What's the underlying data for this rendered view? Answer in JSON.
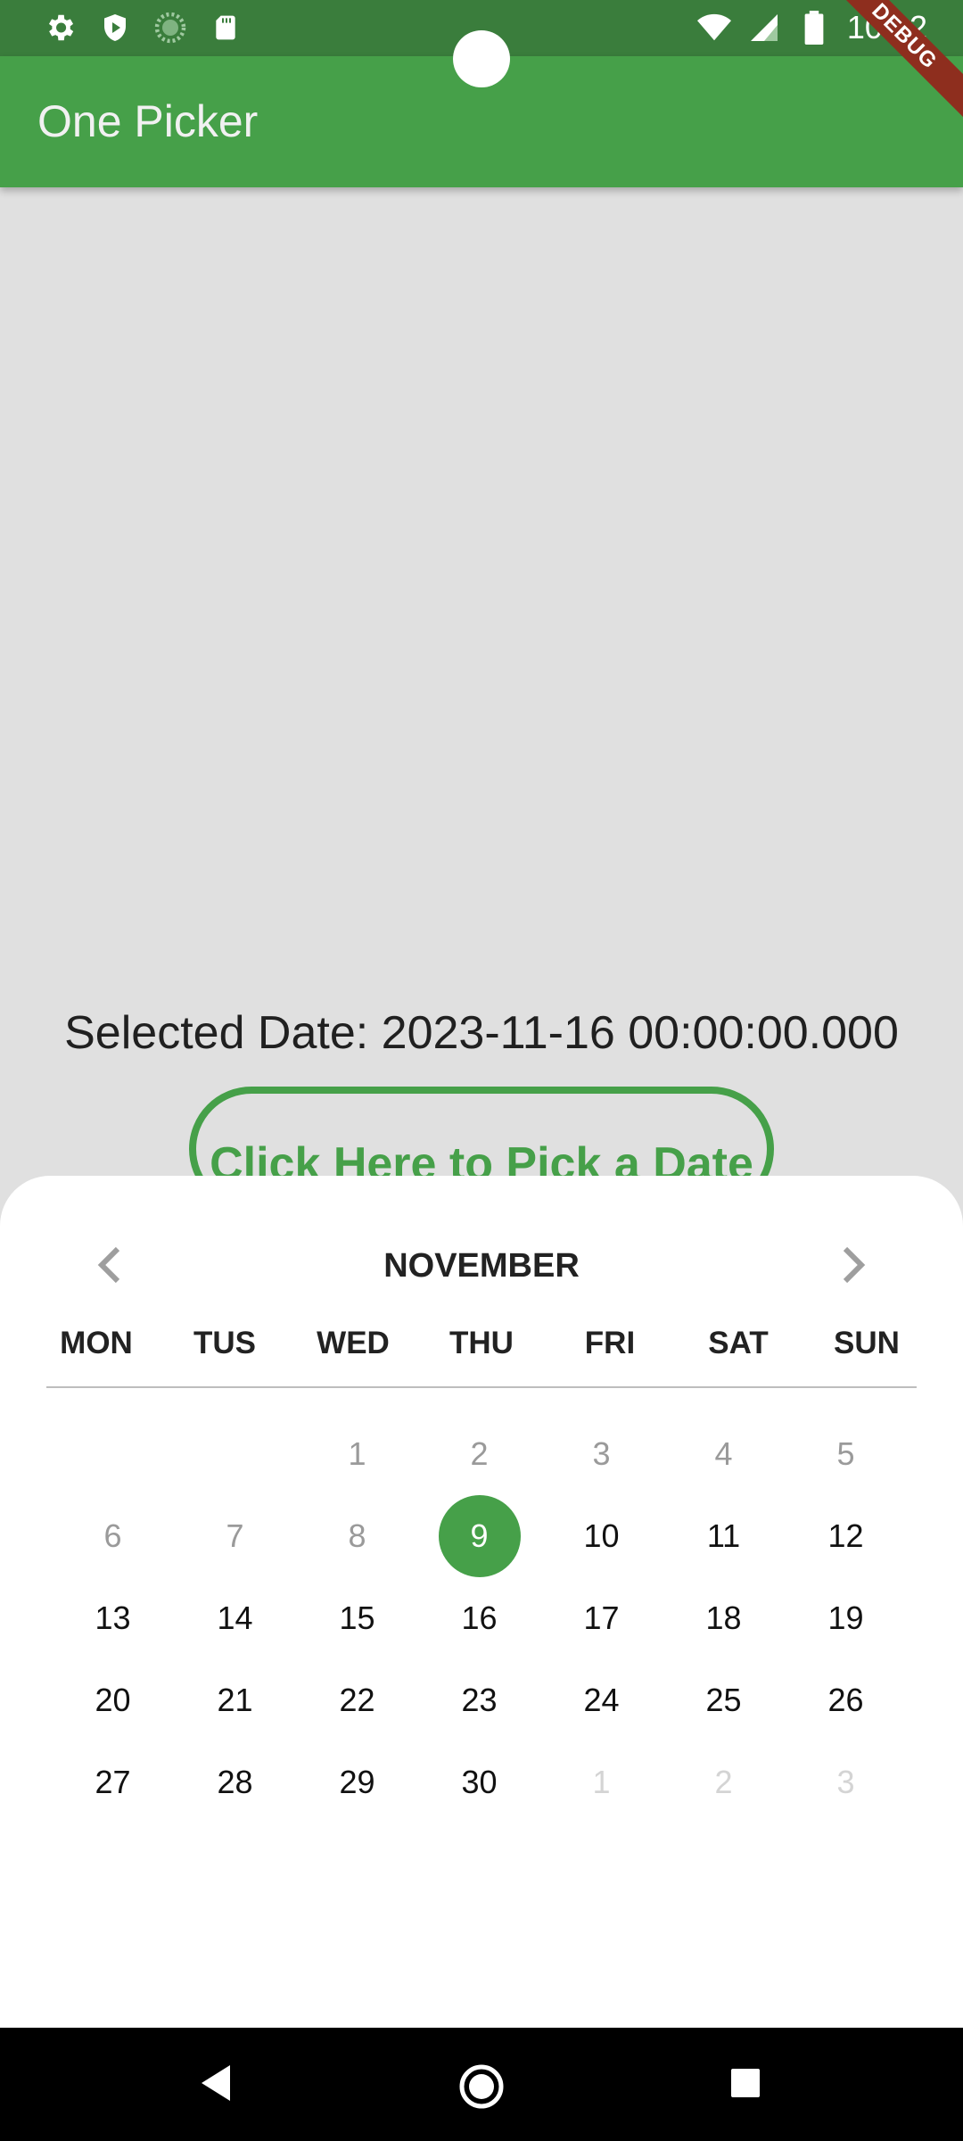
{
  "status_bar": {
    "time": "10:32",
    "icons": [
      "settings-icon",
      "shield-play-icon",
      "loading-dots-icon",
      "sd-card-icon",
      "wifi-icon",
      "signal-icon",
      "battery-icon"
    ]
  },
  "app_bar": {
    "title": "One Picker"
  },
  "debug_banner": "DEBUG",
  "main": {
    "selected_date_text": "Selected Date: 2023-11-16 00:00:00.000",
    "pick_button_label": "Click Here to Pick a Date"
  },
  "calendar": {
    "month": "NOVEMBER",
    "weekdays": [
      "MON",
      "TUS",
      "WED",
      "THU",
      "FRI",
      "SAT",
      "SUN"
    ],
    "weeks": [
      [
        "",
        "",
        "1",
        "2",
        "3",
        "4",
        "5"
      ],
      [
        "6",
        "7",
        "8",
        "9",
        "10",
        "11",
        "12"
      ],
      [
        "13",
        "14",
        "15",
        "16",
        "17",
        "18",
        "19"
      ],
      [
        "20",
        "21",
        "22",
        "23",
        "24",
        "25",
        "26"
      ],
      [
        "27",
        "28",
        "29",
        "30",
        "1",
        "2",
        "3"
      ]
    ],
    "selected_day": "9"
  },
  "colors": {
    "accent": "#46a049",
    "status_bar": "#3a7d3c",
    "sheet": "#ffffff"
  }
}
